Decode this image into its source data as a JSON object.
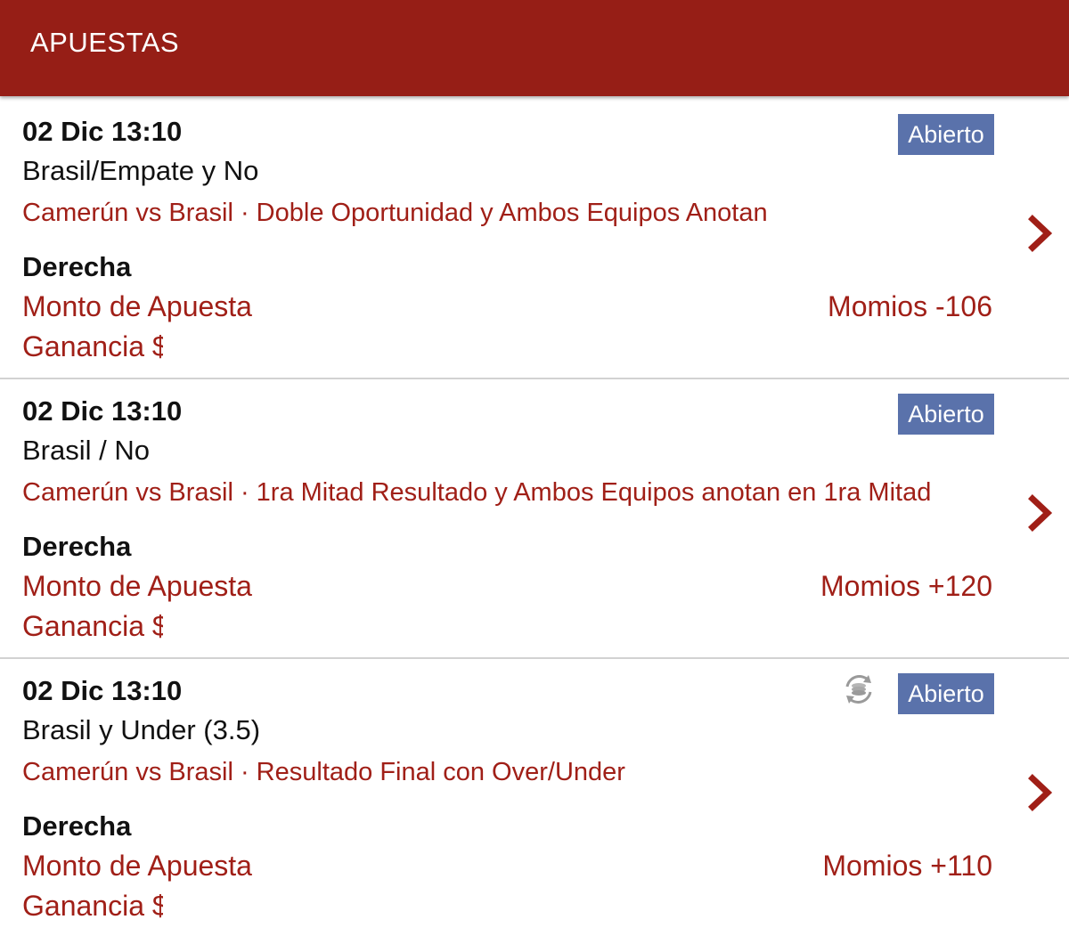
{
  "header": {
    "title": "APUESTAS"
  },
  "bets": [
    {
      "date": "02 Dic 13:10",
      "selection": "Brasil/Empate y No",
      "event": "Camerún vs Brasil · Doble Oportunidad y Ambos Equipos Anotan",
      "side": "Derecha",
      "stake_label": "Monto de Apuesta",
      "odds": "Momios -106",
      "profit_label": "Ganancia $",
      "status": "Abierto"
    },
    {
      "date": "02 Dic 13:10",
      "selection": "Brasil / No",
      "event": "Camerún vs Brasil · 1ra Mitad Resultado y Ambos Equipos anotan en 1ra Mitad",
      "side": "Derecha",
      "stake_label": "Monto de Apuesta",
      "odds": "Momios +120",
      "profit_label": "Ganancia $",
      "status": "Abierto"
    },
    {
      "date": "02 Dic 13:10",
      "selection": "Brasil y Under (3.5)",
      "event": "Camerún vs Brasil · Resultado Final con Over/Under",
      "side": "Derecha",
      "stake_label": "Monto de Apuesta",
      "odds": "Momios +110",
      "profit_label": "Ganancia $",
      "status": "Abierto",
      "extra_icon": "cash-out-refresh-icon"
    }
  ],
  "colors": {
    "header_bg": "#961e16",
    "accent_red": "#a01f17",
    "badge_bg": "#5a72ab"
  },
  "icons": {
    "row_chevron": "chevron-right-icon"
  }
}
